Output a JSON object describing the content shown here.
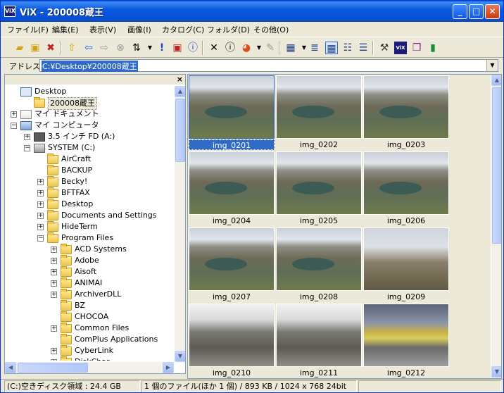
{
  "window": {
    "app_icon_text": "ViX",
    "title": "ViX - 200008蔵王",
    "minimize": "_",
    "maximize": "□",
    "close": "✕"
  },
  "menu": [
    "ファイル(F)",
    "編集(E)",
    "表示(V)",
    "画像(I)",
    "カタログ(C)",
    "フォルダ(D)",
    "その他(O)"
  ],
  "toolbar_icons": [
    "open-folder-icon",
    "new-folder-icon",
    "delete-folder-icon",
    "up-folder-icon",
    "back-arrow-icon",
    "forward-arrow-icon",
    "stop-icon",
    "sort-icon",
    "exclamation-icon",
    "slideshow-icon",
    "info-icon",
    "delete-icon",
    "properties-icon",
    "color-icon",
    "tool-icon",
    "view-mode-icon",
    "list-icon",
    "large-thumbnails-icon",
    "details-icon",
    "filmstrip-icon",
    "hammer-icon",
    "vix-icon",
    "books-icon",
    "exit-icon"
  ],
  "address": {
    "label": "アドレス",
    "value": "C:¥Desktop¥200008蔵王"
  },
  "folder_pane": {
    "close": "×",
    "tree": [
      {
        "label": "Desktop",
        "icon": "desktop-icon",
        "expander": ""
      },
      {
        "label": "200008蔵王",
        "icon": "folder-icon",
        "expander": "",
        "selected": true
      },
      {
        "label": "マイ ドキュメント",
        "icon": "documents-icon",
        "expander": "+"
      },
      {
        "label": "マイ コンピュータ",
        "icon": "computer-icon",
        "expander": "−"
      },
      {
        "label": "3.5 インチ FD (A:)",
        "icon": "floppy-icon",
        "expander": "+"
      },
      {
        "label": "SYSTEM (C:)",
        "icon": "drive-icon",
        "expander": "−"
      },
      {
        "label": "AirCraft",
        "icon": "folder-icon",
        "expander": ""
      },
      {
        "label": "BACKUP",
        "icon": "folder-icon",
        "expander": ""
      },
      {
        "label": "Becky!",
        "icon": "folder-icon",
        "expander": "+"
      },
      {
        "label": "BFTFAX",
        "icon": "folder-icon",
        "expander": "+"
      },
      {
        "label": "Desktop",
        "icon": "folder-icon",
        "expander": "+"
      },
      {
        "label": "Documents and Settings",
        "icon": "folder-icon",
        "expander": "+"
      },
      {
        "label": "HideTerm",
        "icon": "folder-icon",
        "expander": "+"
      },
      {
        "label": "Program Files",
        "icon": "folder-icon",
        "expander": "−"
      },
      {
        "label": "ACD Systems",
        "icon": "folder-icon",
        "expander": "+"
      },
      {
        "label": "Adobe",
        "icon": "folder-icon",
        "expander": "+"
      },
      {
        "label": "Aisoft",
        "icon": "folder-icon",
        "expander": "+"
      },
      {
        "label": "ANIMAI",
        "icon": "folder-icon",
        "expander": "+"
      },
      {
        "label": "ArchiverDLL",
        "icon": "folder-icon",
        "expander": "+"
      },
      {
        "label": "BZ",
        "icon": "folder-icon",
        "expander": ""
      },
      {
        "label": "CHOCOA",
        "icon": "folder-icon",
        "expander": ""
      },
      {
        "label": "Common Files",
        "icon": "folder-icon",
        "expander": "+"
      },
      {
        "label": "ComPlus Applications",
        "icon": "folder-icon",
        "expander": ""
      },
      {
        "label": "CyberLink",
        "icon": "folder-icon",
        "expander": "+"
      },
      {
        "label": "DiskChar",
        "icon": "folder-icon",
        "expander": "+"
      }
    ]
  },
  "thumbnails": [
    {
      "name": "img_0201",
      "style": "mountain",
      "selected": true
    },
    {
      "name": "img_0202",
      "style": "mountain"
    },
    {
      "name": "img_0203",
      "style": "mountain"
    },
    {
      "name": "img_0204",
      "style": "mountain"
    },
    {
      "name": "img_0205",
      "style": "mountain"
    },
    {
      "name": "img_0206",
      "style": "mountain"
    },
    {
      "name": "img_0207",
      "style": "mountain"
    },
    {
      "name": "img_0208",
      "style": "mountain"
    },
    {
      "name": "img_0209",
      "style": "sky"
    },
    {
      "name": "img_0210",
      "style": "rocks"
    },
    {
      "name": "img_0211",
      "style": "rocks"
    },
    {
      "name": "img_0212",
      "style": "town"
    }
  ],
  "status": {
    "disk_free": "(C:)空きディスク領域 : 24.4 GB",
    "selection_info": "1 個のファイル(ほか 1 個) / 893 KB / 1024 x 768 24bit"
  }
}
